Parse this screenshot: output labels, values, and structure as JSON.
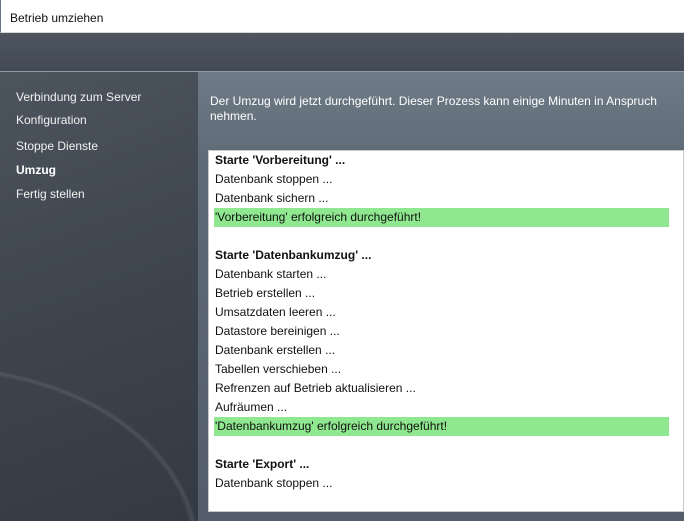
{
  "window": {
    "title": "Betrieb umziehen"
  },
  "sidebar": {
    "items": [
      {
        "label": "Verbindung zum Server",
        "active": false
      },
      {
        "label": "Konfiguration",
        "active": false
      },
      {
        "label": "Stoppe Dienste",
        "active": false
      },
      {
        "label": "Umzug",
        "active": true
      },
      {
        "label": "Fertig stellen",
        "active": false
      }
    ]
  },
  "main": {
    "intro": "Der Umzug wird jetzt durchgeführt. Dieser Prozess kann einige Minuten in Anspruch nehmen.",
    "log": [
      {
        "text": "Starte 'Vorbereitung' ...",
        "kind": "head"
      },
      {
        "text": "Datenbank stoppen ...",
        "kind": "step"
      },
      {
        "text": "Datenbank sichern ...",
        "kind": "step"
      },
      {
        "text": "'Vorbereitung' erfolgreich durchgeführt!",
        "kind": "ok"
      },
      {
        "text": "Starte 'Datenbankumzug' ...",
        "kind": "head"
      },
      {
        "text": "Datenbank starten ...",
        "kind": "step"
      },
      {
        "text": "Betrieb erstellen ...",
        "kind": "step"
      },
      {
        "text": "Umsatzdaten leeren ...",
        "kind": "step"
      },
      {
        "text": "Datastore bereinigen ...",
        "kind": "step"
      },
      {
        "text": "Datenbank erstellen ...",
        "kind": "step"
      },
      {
        "text": "Tabellen verschieben ...",
        "kind": "step"
      },
      {
        "text": "Refrenzen auf Betrieb aktualisieren ...",
        "kind": "step"
      },
      {
        "text": "Aufräumen ...",
        "kind": "step"
      },
      {
        "text": "'Datenbankumzug' erfolgreich durchgeführt!",
        "kind": "ok"
      },
      {
        "text": "Starte 'Export' ...",
        "kind": "head"
      },
      {
        "text": "Datenbank stoppen ...",
        "kind": "step"
      }
    ]
  },
  "colors": {
    "success": "#8fe88f",
    "banner": "#4a525c"
  }
}
